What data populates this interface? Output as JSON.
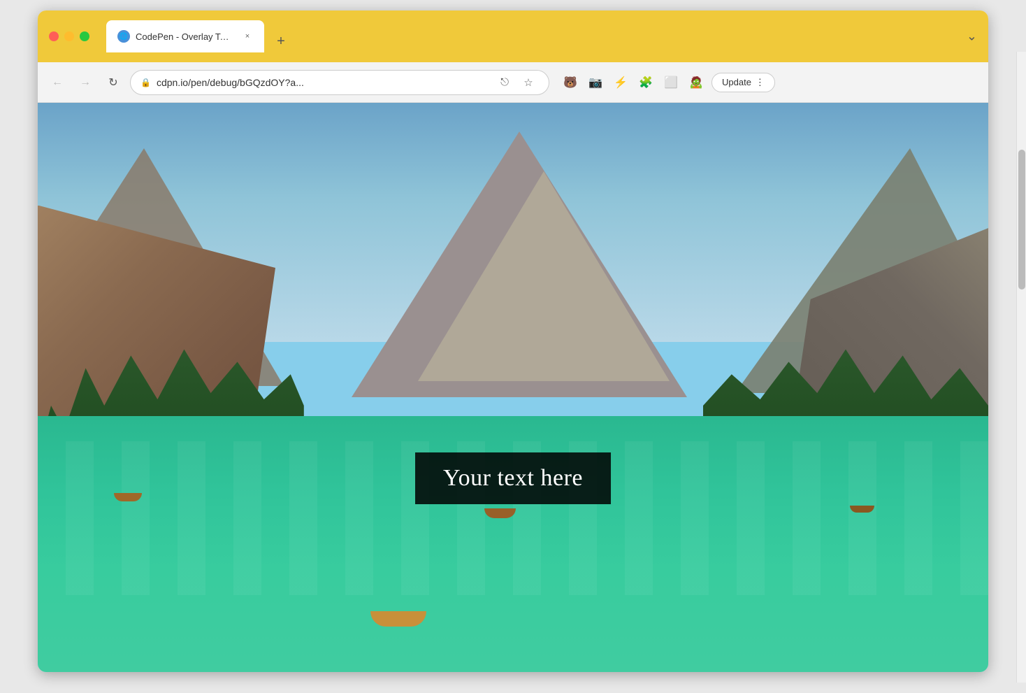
{
  "browser": {
    "title_bar": {
      "tab": {
        "favicon": "🌐",
        "title": "CodePen - Overlay Text on Ima",
        "close_label": "×"
      },
      "new_tab_label": "+",
      "overflow_label": "⌄"
    },
    "navbar": {
      "back_label": "←",
      "forward_label": "→",
      "reload_label": "↻",
      "address": "cdpn.io/pen/debug/bGQzdOY?a...",
      "lock_icon": "🔒",
      "share_label": "⎋",
      "bookmark_label": "☆",
      "bear_ext": "🐻",
      "camera_ext": "📷",
      "lightning_ext": "⚡",
      "puzzle_ext": "🧩",
      "sidebar_ext": "⬜",
      "avatar_ext": "🧟",
      "update_btn_label": "Update",
      "menu_btn_label": "⋮"
    },
    "scrollbar": {
      "visible": true
    }
  },
  "content": {
    "overlay_text": "Your text here"
  }
}
